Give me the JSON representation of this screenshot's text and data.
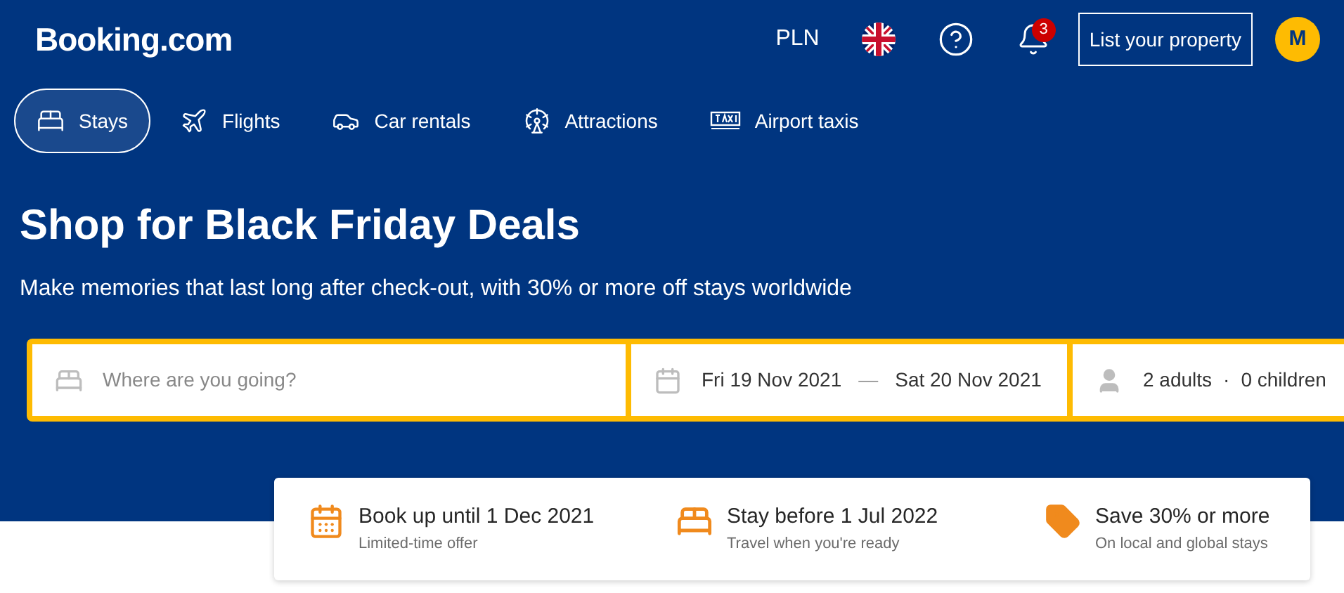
{
  "header": {
    "logo": "Booking.com",
    "currency": "PLN",
    "notifications": {
      "count": "3"
    },
    "list_property": "List your property",
    "avatar": "M"
  },
  "nav": [
    {
      "label": "Stays",
      "kind": "bed",
      "selected": true
    },
    {
      "label": "Flights",
      "kind": "plane",
      "selected": false
    },
    {
      "label": "Car rentals",
      "kind": "car",
      "selected": false
    },
    {
      "label": "Attractions",
      "kind": "wheel",
      "selected": false
    },
    {
      "label": "Airport taxis",
      "kind": "taxi",
      "selected": false
    }
  ],
  "hero": {
    "title": "Shop for Black Friday Deals",
    "subtitle": "Make memories that last long after check-out, with 30% or more off stays worldwide"
  },
  "search": {
    "destination": {
      "placeholder": "Where are you going?"
    },
    "check_in": "Fri 19 Nov 2021",
    "date_separator": "—",
    "check_out": "Sat 20 Nov 2021",
    "adults": "2 adults",
    "guest_separator": "·",
    "children": "0 children"
  },
  "offers": [
    {
      "kind": "calendar",
      "title": "Book up until 1 Dec 2021",
      "subtitle": "Limited-time offer"
    },
    {
      "kind": "bed",
      "title": "Stay before 1 Jul 2022",
      "subtitle": "Travel when you're ready"
    },
    {
      "kind": "tag",
      "title": "Save 30% or more",
      "subtitle": "On local and global stays"
    }
  ]
}
